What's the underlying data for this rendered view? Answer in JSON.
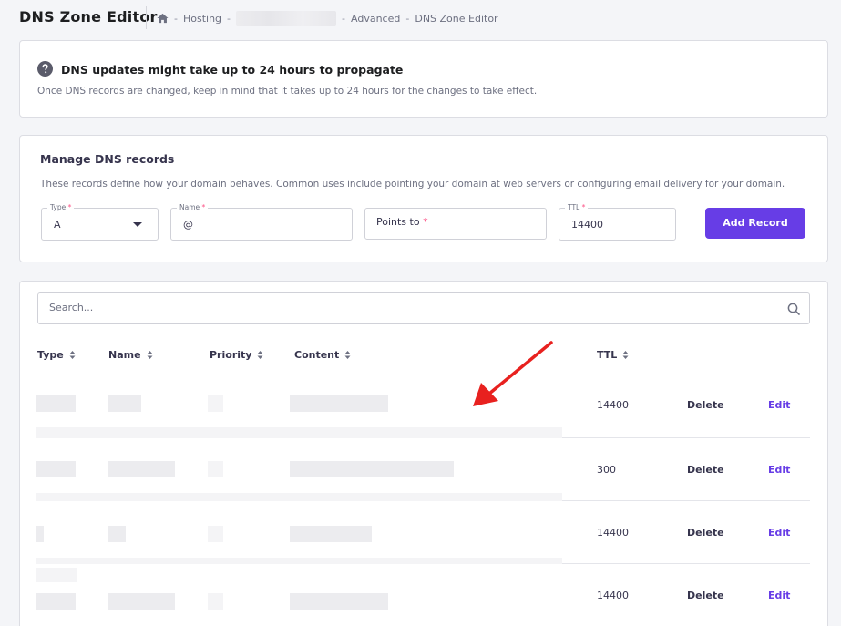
{
  "header": {
    "title": "DNS Zone Editor",
    "breadcrumb": [
      "Hosting",
      "Advanced",
      "DNS Zone Editor"
    ],
    "sep": "-"
  },
  "notice": {
    "title": "DNS updates might take up to 24 hours to propagate",
    "text": "Once DNS records are changed, keep in mind that it takes up to 24 hours for the changes to take effect."
  },
  "manage": {
    "title": "Manage DNS records",
    "description": "These records define how your domain behaves. Common uses include pointing your domain at web servers or configuring email delivery for your domain.",
    "type_label": "Type",
    "type_value": "A",
    "name_label": "Name",
    "name_value": "@",
    "points_label": "Points to",
    "ttl_label": "TTL",
    "ttl_value": "14400",
    "required_mark": "*",
    "add_button": "Add Record"
  },
  "table": {
    "search_placeholder": "Search...",
    "columns": [
      "Type",
      "Name",
      "Priority",
      "Content",
      "TTL"
    ],
    "rows": [
      {
        "ttl": "14400",
        "delete": "Delete",
        "edit": "Edit"
      },
      {
        "ttl": "300",
        "delete": "Delete",
        "edit": "Edit"
      },
      {
        "ttl": "14400",
        "delete": "Delete",
        "edit": "Edit"
      },
      {
        "ttl": "14400",
        "delete": "Delete",
        "edit": "Edit"
      }
    ]
  },
  "colors": {
    "accent": "#673de6",
    "annotation_arrow": "#e8211f"
  }
}
